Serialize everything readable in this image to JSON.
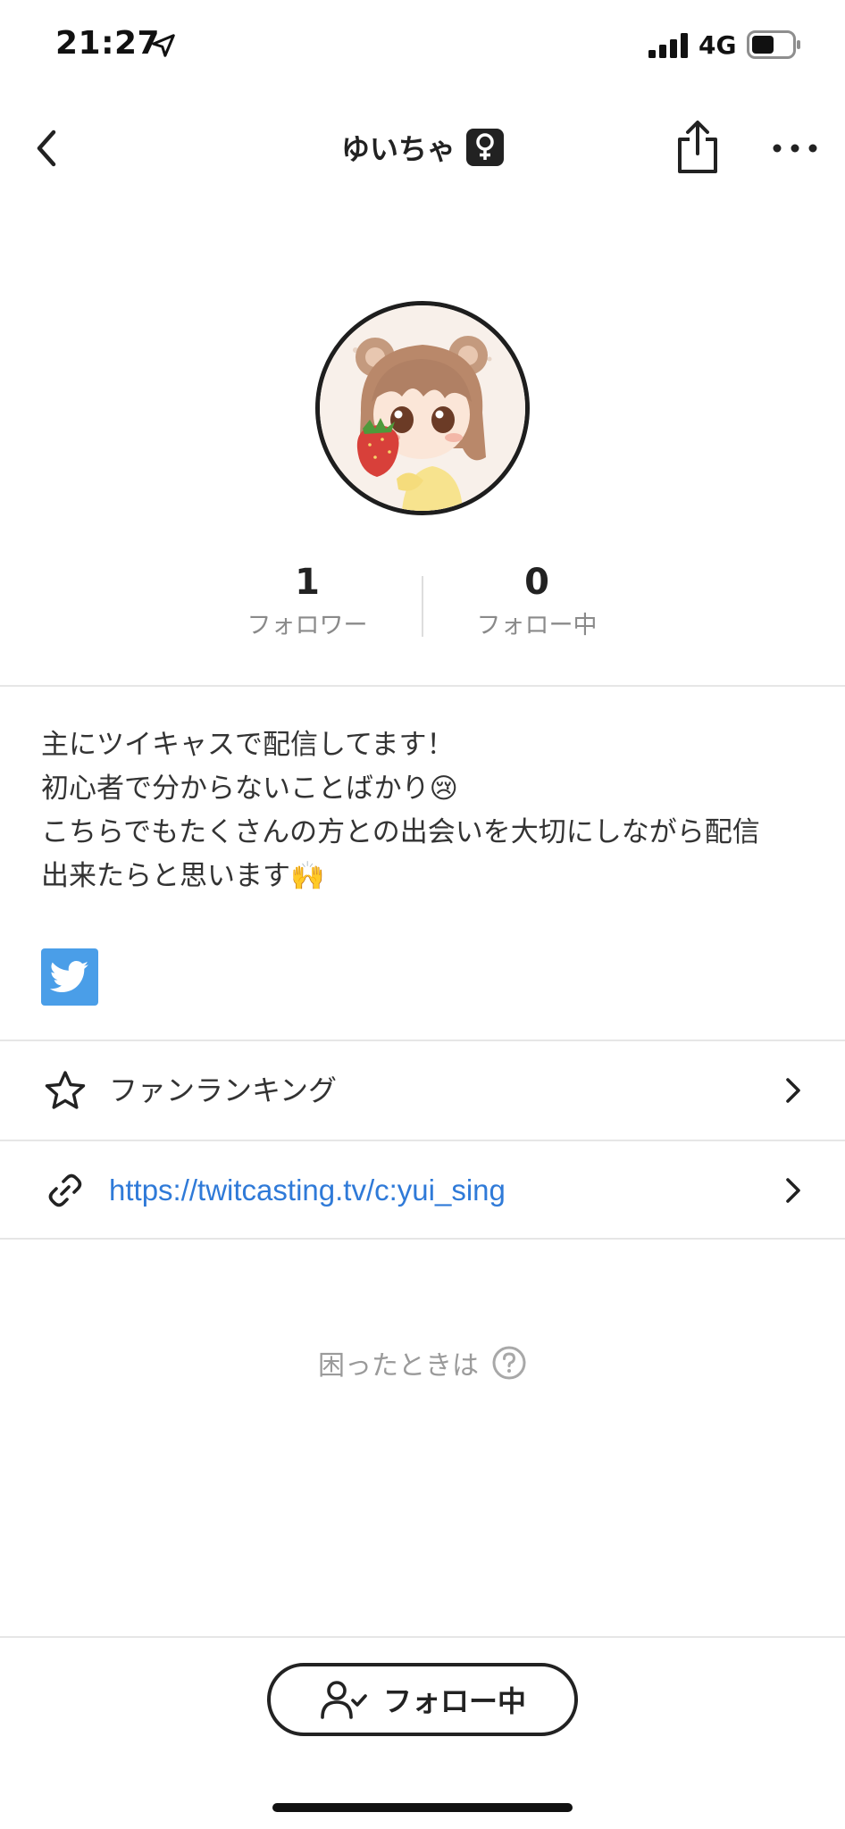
{
  "status_bar": {
    "time": "21:27",
    "network": "4G",
    "icons": [
      "location-arrow-icon",
      "signal-bars-icon",
      "battery-icon"
    ]
  },
  "nav": {
    "title": "ゆいちゃ",
    "gender_badge": "♀",
    "icons": [
      "chevron-left-icon",
      "share-icon",
      "more-icon"
    ]
  },
  "profile": {
    "avatar": "avatar-illustration"
  },
  "stats": {
    "followers_count": "1",
    "followers_label": "フォロワー",
    "following_count": "0",
    "following_label": "フォロー中"
  },
  "bio": {
    "lines": [
      "主にツイキャスで配信してます！",
      "初心者で分からないことばかり😢",
      "こちらでもたくさんの方との出会いを大切にしながら配信",
      "出来たらと思います🙌"
    ]
  },
  "social": {
    "twitter_icon": "twitter-bird-icon"
  },
  "rows": {
    "fan_ranking_label": "ファンランキング",
    "link_url": "https://twitcasting.tv/c:yui_sing"
  },
  "help": {
    "label": "困ったときは",
    "icon": "question-circle-icon"
  },
  "follow_button": {
    "label": "フォロー中",
    "icon": "user-check-icon"
  },
  "colors": {
    "link": "#2f7ad8",
    "twitter": "#4a9ee8",
    "muted_text": "#8a8a8a",
    "divider": "#e6e6e6"
  }
}
